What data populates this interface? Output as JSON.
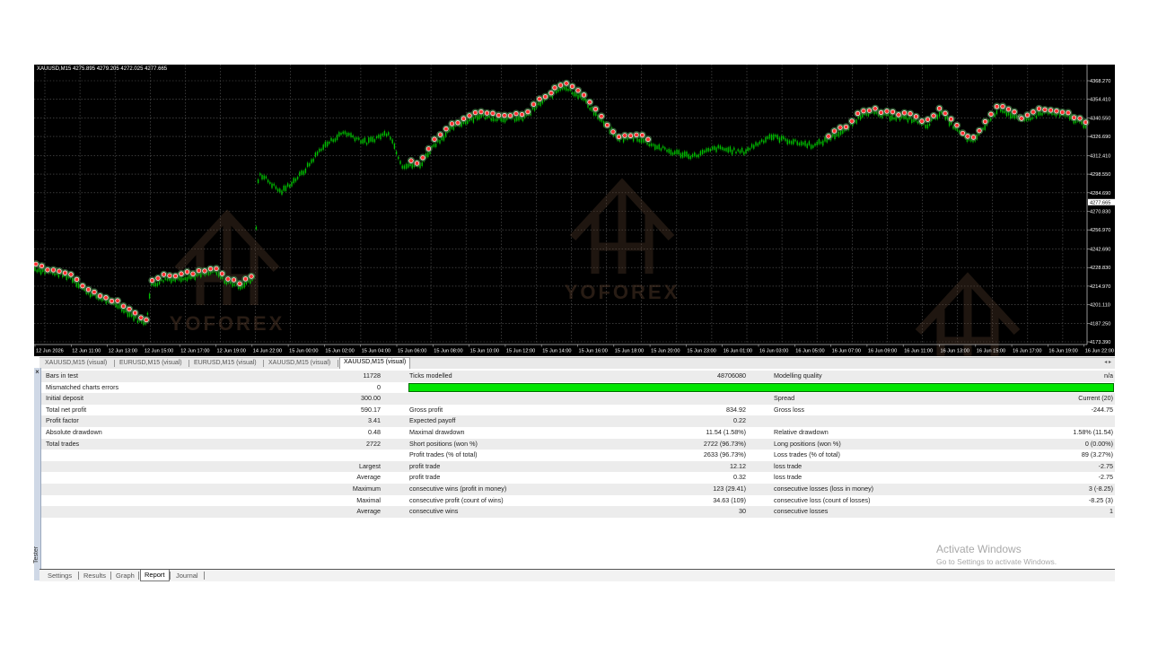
{
  "chart": {
    "title": "XAUUSD,M15  4275.895 4279.205 4272.025 4277.665",
    "watermark": "YOFOREX",
    "current_price": "4277.665",
    "price_labels": [
      "4368.270",
      "4354.410",
      "4340.550",
      "4326.690",
      "4312.410",
      "4298.550",
      "4284.690",
      "4270.830",
      "4256.970",
      "4242.690",
      "4228.830",
      "4214.970",
      "4201.110",
      "4187.250",
      "4173.390"
    ],
    "time_labels": [
      "12 Jun 2026",
      "12 Jun 11:00",
      "12 Jun 13:00",
      "12 Jun 15:00",
      "12 Jun 17:00",
      "12 Jun 19:00",
      "14 Jun 22:00",
      "15 Jun 00:00",
      "15 Jun 02:00",
      "15 Jun 04:00",
      "15 Jun 06:00",
      "15 Jun 08:00",
      "15 Jun 10:00",
      "15 Jun 12:00",
      "15 Jun 14:00",
      "15 Jun 16:00",
      "15 Jun 18:00",
      "15 Jun 20:00",
      "15 Jun 23:00",
      "16 Jun 01:00",
      "16 Jun 03:00",
      "16 Jun 05:00",
      "16 Jun 07:00",
      "16 Jun 09:00",
      "16 Jun 11:00",
      "16 Jun 13:00",
      "16 Jun 15:00",
      "16 Jun 17:00",
      "16 Jun 19:00",
      "16 Jun 22:00"
    ],
    "colors": {
      "background": "#000000",
      "candle": "#00c000",
      "marker": "#ff3030",
      "grid": "#5a5a5a"
    }
  },
  "chart_tabs": [
    "XAUUSD,M15 (visual)",
    "EURUSD,M15 (visual)",
    "EURUSD,M15 (visual)",
    "XAUUSD,M15 (visual)",
    "XAUUSD,M15 (visual)"
  ],
  "active_chart_tab": 4,
  "tester_label": "Tester",
  "report": {
    "bars_in_test": {
      "label": "Bars in test",
      "value": "11728"
    },
    "ticks_modelled": {
      "label": "Ticks modelled",
      "value": "48706080"
    },
    "modelling_quality": {
      "label": "Modelling quality",
      "value": "n/a"
    },
    "mismatched": {
      "label": "Mismatched charts errors",
      "value": "0"
    },
    "initial_deposit": {
      "label": "Initial deposit",
      "value": "300.00"
    },
    "spread": {
      "label": "Spread",
      "value": "Current (20)"
    },
    "total_net_profit": {
      "label": "Total net profit",
      "value": "590.17"
    },
    "gross_profit": {
      "label": "Gross profit",
      "value": "834.92"
    },
    "gross_loss": {
      "label": "Gross loss",
      "value": "-244.75"
    },
    "profit_factor": {
      "label": "Profit factor",
      "value": "3.41"
    },
    "expected_payoff": {
      "label": "Expected payoff",
      "value": "0.22"
    },
    "absolute_drawdown": {
      "label": "Absolute drawdown",
      "value": "0.48"
    },
    "maximal_drawdown": {
      "label": "Maximal drawdown",
      "value": "11.54 (1.58%)"
    },
    "relative_drawdown": {
      "label": "Relative drawdown",
      "value": "1.58% (11.54)"
    },
    "total_trades": {
      "label": "Total trades",
      "value": "2722"
    },
    "short_positions": {
      "label": "Short positions (won %)",
      "value": "2722 (96.73%)"
    },
    "long_positions": {
      "label": "Long positions (won %)",
      "value": "0 (0.00%)"
    },
    "profit_trades": {
      "label": "Profit trades (% of total)",
      "value": "2633 (96.73%)"
    },
    "loss_trades": {
      "label": "Loss trades (% of total)",
      "value": "89 (3.27%)"
    },
    "largest": {
      "label": "Largest",
      "p_label": "profit trade",
      "p_value": "12.12",
      "l_label": "loss trade",
      "l_value": "-2.75"
    },
    "average": {
      "label": "Average",
      "p_label": "profit trade",
      "p_value": "0.32",
      "l_label": "loss trade",
      "l_value": "-2.75"
    },
    "maximum": {
      "label": "Maximum",
      "p_label": "consecutive wins (profit in money)",
      "p_value": "123 (29.41)",
      "l_label": "consecutive losses (loss in money)",
      "l_value": "3 (-8.25)"
    },
    "maximal": {
      "label": "Maximal",
      "p_label": "consecutive profit (count of wins)",
      "p_value": "34.63 (109)",
      "l_label": "consecutive loss (count of losses)",
      "l_value": "-8.25 (3)"
    },
    "average_consec": {
      "label": "Average",
      "p_label": "consecutive wins",
      "p_value": "30",
      "l_label": "consecutive losses",
      "l_value": "1"
    }
  },
  "bottom_tabs": [
    "Settings",
    "Results",
    "Graph",
    "Report",
    "Journal"
  ],
  "active_bottom_tab": 3,
  "activate_windows": {
    "title": "Activate Windows",
    "subtitle": "Go to Settings to activate Windows."
  }
}
